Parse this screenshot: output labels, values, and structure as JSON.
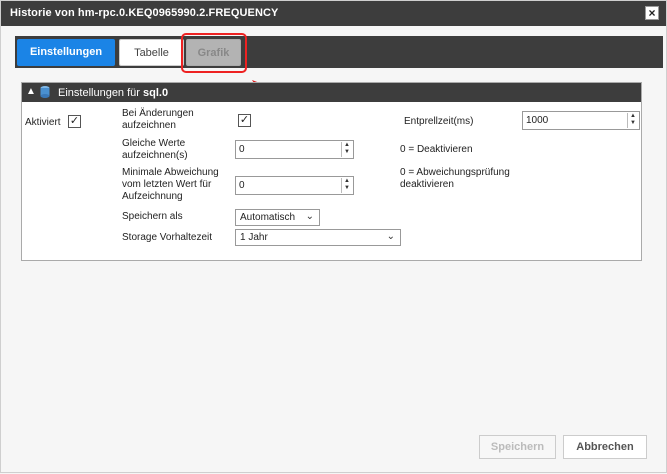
{
  "dialog": {
    "title": "Historie von hm-rpc.0.KEQ0965990.2.FREQUENCY",
    "close_label": "×"
  },
  "tabs": [
    {
      "label": "Einstellungen",
      "active": true
    },
    {
      "label": "Tabelle",
      "active": false
    },
    {
      "label": "Grafik",
      "active": false
    }
  ],
  "panel": {
    "title_prefix": "Einstellungen für",
    "title_instance": "sql.0",
    "collapse_arrow": "▲"
  },
  "settings": {
    "aktiviert_label": "Aktiviert",
    "aktiviert_checked": true,
    "changes_label": "Bei Änderungen aufzeichnen",
    "changes_checked": true,
    "entprell_label": "Entprellzeit(ms)",
    "entprell_value": "1000",
    "same_label": "Gleiche Werte aufzeichnen(s)",
    "same_value": "0",
    "same_hint": "0 = Deaktivieren",
    "deviation_label": "Minimale Abweichung vom letzten Wert für Aufzeichnung",
    "deviation_value": "0",
    "deviation_hint": "0 = Abweichungsprüfung deaktivieren",
    "save_as_label": "Speichern als",
    "save_as_value": "Automatisch",
    "storage_label": "Storage Vorhaltezeit",
    "storage_value": "1 Jahr"
  },
  "footer": {
    "save_label": "Speichern",
    "cancel_label": "Abbrechen"
  },
  "colors": {
    "active_tab": "#1b84e6",
    "titlebar": "#3d3d3d",
    "highlight": "#e22222"
  }
}
